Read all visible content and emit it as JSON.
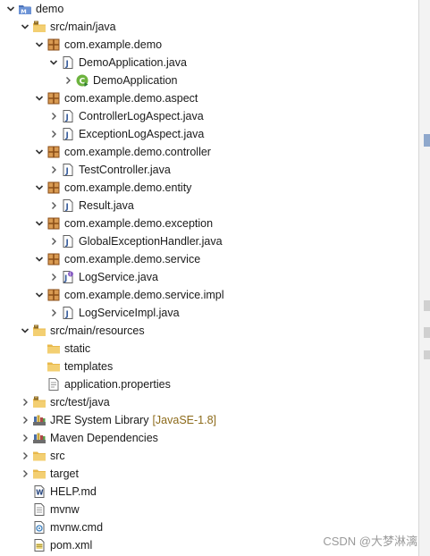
{
  "tree": [
    {
      "label": "demo",
      "icon": "project-icon",
      "chevron": "down",
      "level": 0
    },
    {
      "label": "src/main/java",
      "icon": "source-folder-icon",
      "chevron": "down",
      "level": 1
    },
    {
      "label": "com.example.demo",
      "icon": "package-icon",
      "chevron": "down",
      "level": 2
    },
    {
      "label": "DemoApplication.java",
      "icon": "java-file-icon",
      "chevron": "down",
      "level": 3
    },
    {
      "label": "DemoApplication",
      "icon": "spring-boot-class-icon",
      "chevron": "right",
      "level": 4
    },
    {
      "label": "com.example.demo.aspect",
      "icon": "package-icon",
      "chevron": "down",
      "level": 2
    },
    {
      "label": "ControllerLogAspect.java",
      "icon": "java-file-icon",
      "chevron": "right",
      "level": 3
    },
    {
      "label": "ExceptionLogAspect.java",
      "icon": "java-file-icon",
      "chevron": "right",
      "level": 3
    },
    {
      "label": "com.example.demo.controller",
      "icon": "package-icon",
      "chevron": "down",
      "level": 2
    },
    {
      "label": "TestController.java",
      "icon": "java-file-icon",
      "chevron": "right",
      "level": 3
    },
    {
      "label": "com.example.demo.entity",
      "icon": "package-icon",
      "chevron": "down",
      "level": 2
    },
    {
      "label": "Result.java",
      "icon": "java-file-icon",
      "chevron": "right",
      "level": 3
    },
    {
      "label": "com.example.demo.exception",
      "icon": "package-icon",
      "chevron": "down",
      "level": 2
    },
    {
      "label": "GlobalExceptionHandler.java",
      "icon": "java-file-icon",
      "chevron": "right",
      "level": 3
    },
    {
      "label": "com.example.demo.service",
      "icon": "package-icon",
      "chevron": "down",
      "level": 2
    },
    {
      "label": "LogService.java",
      "icon": "java-interface-file-icon",
      "chevron": "right",
      "level": 3
    },
    {
      "label": "com.example.demo.service.impl",
      "icon": "package-icon",
      "chevron": "down",
      "level": 2
    },
    {
      "label": "LogServiceImpl.java",
      "icon": "java-file-icon",
      "chevron": "right",
      "level": 3
    },
    {
      "label": "src/main/resources",
      "icon": "source-folder-icon",
      "chevron": "down",
      "level": 1
    },
    {
      "label": "static",
      "icon": "folder-icon",
      "chevron": "none",
      "level": 2
    },
    {
      "label": "templates",
      "icon": "folder-icon",
      "chevron": "none",
      "level": 2
    },
    {
      "label": "application.properties",
      "icon": "properties-file-icon",
      "chevron": "none",
      "level": 2
    },
    {
      "label": "src/test/java",
      "icon": "source-folder-icon",
      "chevron": "right",
      "level": 1
    },
    {
      "label": "JRE System Library",
      "decoration": "[JavaSE-1.8]",
      "icon": "library-icon",
      "chevron": "right",
      "level": 1
    },
    {
      "label": "Maven Dependencies",
      "icon": "library-icon",
      "chevron": "right",
      "level": 1
    },
    {
      "label": "src",
      "icon": "folder-icon",
      "chevron": "right",
      "level": 1
    },
    {
      "label": "target",
      "icon": "folder-icon",
      "chevron": "right",
      "level": 1
    },
    {
      "label": "HELP.md",
      "icon": "markdown-file-icon",
      "chevron": "none",
      "level": 1
    },
    {
      "label": "mvnw",
      "icon": "text-file-icon",
      "chevron": "none",
      "level": 1
    },
    {
      "label": "mvnw.cmd",
      "icon": "cmd-file-icon",
      "chevron": "none",
      "level": 1
    },
    {
      "label": "pom.xml",
      "icon": "xml-file-icon",
      "chevron": "none",
      "level": 1
    }
  ],
  "watermark": "CSDN @大梦淋漓",
  "colors": {
    "folder": "#e8b84a",
    "package": "#b07a3a",
    "java_j": "#3a5f9e",
    "spring": "#6db33f",
    "library": "#4b6ea8"
  }
}
